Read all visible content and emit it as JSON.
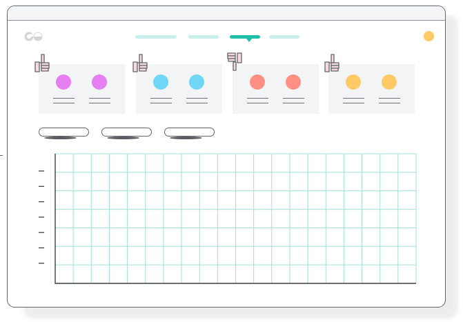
{
  "header": {
    "nav_tabs": [
      {
        "name": "nav-tab-1",
        "active": false
      },
      {
        "name": "nav-tab-2",
        "active": false
      },
      {
        "name": "nav-tab-3",
        "active": true
      },
      {
        "name": "nav-tab-4",
        "active": false
      }
    ],
    "avatar_color": "#ffc966"
  },
  "cards": [
    {
      "thumb": "thumbs-up-icon",
      "dot_color": "#e57ff2"
    },
    {
      "thumb": "thumbs-up-icon",
      "dot_color": "#6fd6f6"
    },
    {
      "thumb": "thumbs-down-icon",
      "dot_color": "#ff8f85"
    },
    {
      "thumb": "thumbs-up-icon",
      "dot_color": "#ffc966"
    }
  ],
  "filter_buttons": [
    {
      "name": "filter-button-1"
    },
    {
      "name": "filter-button-2"
    },
    {
      "name": "filter-button-3"
    }
  ],
  "chart_data": {
    "type": "table",
    "title": "",
    "xlabel": "",
    "ylabel": "",
    "grid": true,
    "grid_color": "#9fe0d8",
    "columns": 20,
    "rows": 7,
    "y_ticks": 7
  },
  "colors": {
    "accent": "#21bfa8",
    "accent_light": "#c8efea",
    "border": "#5f646b",
    "card_bg": "#f3f4f5"
  }
}
